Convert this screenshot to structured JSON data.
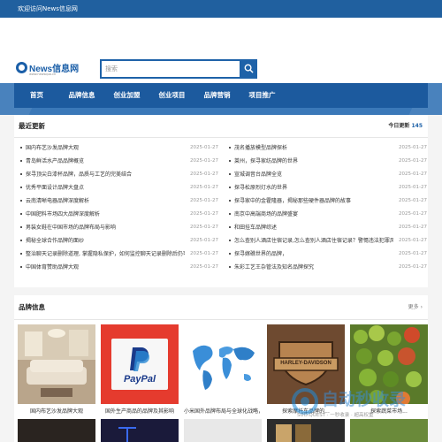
{
  "topbar": {
    "welcome": "欢迎访问News信息网"
  },
  "logo": {
    "name": "News信息网",
    "sub": "www.newsquo.cn"
  },
  "search": {
    "placeholder": "搜索"
  },
  "nav": [
    "首页",
    "品牌信息",
    "创业加盟",
    "创业项目",
    "品牌营销",
    "项目推广"
  ],
  "news": {
    "title": "最近更新",
    "today_label": "今日更新",
    "today_count": "145",
    "left": [
      {
        "title": "国内布艺沙发品牌大观",
        "date": "2025-01-27"
      },
      {
        "title": "青岛鲜活水产品品牌概览",
        "date": "2025-01-27"
      },
      {
        "title": "探寻顶尖白漆杯品牌，品质与工艺的完美结合",
        "date": "2025-01-27"
      },
      {
        "title": "优秀平面设计品牌大盘点",
        "date": "2025-01-27"
      },
      {
        "title": "云南清晰电器品牌深度解析",
        "date": "2025-01-27"
      },
      {
        "title": "中国肥料市场四大品牌深度解析",
        "date": "2025-01-27"
      },
      {
        "title": "男装女鞋在中国市场的品牌布局与影响",
        "date": "2025-01-27"
      },
      {
        "title": "揭秘全球合作品牌的面纱",
        "date": "2025-01-27"
      },
      {
        "title": "整治聊天记录删除道理, 掌握隐私保护，如何监控聊天记录删除后仍可找回",
        "date": "2025-01-27"
      },
      {
        "title": "中国体育赞助品牌大观",
        "date": "2025-01-27"
      }
    ],
    "right": [
      {
        "title": "茂名播放模型品牌探析",
        "date": "2025-01-27"
      },
      {
        "title": "莱州，探寻家纺品牌的世界",
        "date": "2025-01-27"
      },
      {
        "title": "宣城调音台品牌全览",
        "date": "2025-01-27"
      },
      {
        "title": "探寻松原烈灯水的世界",
        "date": "2025-01-27"
      },
      {
        "title": "探寻家中的金霍隆器，揭秘那些硬件器品牌的故事",
        "date": "2025-01-27"
      },
      {
        "title": "南京中高端商场的品牌盛宴",
        "date": "2025-01-27"
      },
      {
        "title": "和田挂车品牌综述",
        "date": "2025-01-27"
      },
      {
        "title": "怎么查别人酒店住宿记录,怎么查别人酒店住宿记录？警惕违法犯罪风险！",
        "date": "2025-01-27"
      },
      {
        "title": "探寻嫁礁世界的品牌，",
        "date": "2025-01-27"
      },
      {
        "title": "朱彩工艺王杂管法及知名品牌探究",
        "date": "2025-01-27"
      }
    ]
  },
  "brands": {
    "title": "品牌信息",
    "more": "更多",
    "cards": [
      {
        "caption": "国内布艺沙发品牌大观"
      },
      {
        "caption": "国外生产商品的品牌及其影响"
      },
      {
        "caption": "小米国外品牌布局与全球化战略，..."
      },
      {
        "caption": "探索摩托车品牌的..."
      },
      {
        "caption": "探索蔬菜市场..."
      }
    ],
    "paypal_text": "PayPal",
    "harley_text": "HARLEY-DAVIDSON"
  },
  "watermark": {
    "main": "自动秒收录",
    "sub": "SUO.QUEST  ·  一秒收录 · 超高权重"
  },
  "colors": {
    "primary": "#1e62a8",
    "topbar": "#20609f",
    "nav": "#1c5a9e"
  }
}
